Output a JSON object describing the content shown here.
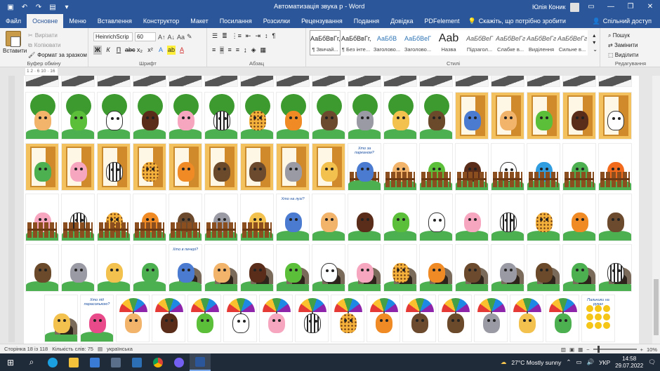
{
  "title_bar": {
    "doc_title": "Автоматизація звука р  -  Word",
    "user_name": "Юлія Коник",
    "qat_icons": [
      "save-icon",
      "undo-icon",
      "redo-icon",
      "new-doc-icon",
      "customize-icon"
    ]
  },
  "tabs": [
    {
      "label": "Файл",
      "active": false
    },
    {
      "label": "Основне",
      "active": true
    },
    {
      "label": "Меню",
      "active": false
    },
    {
      "label": "Вставлення",
      "active": false
    },
    {
      "label": "Конструктор",
      "active": false
    },
    {
      "label": "Макет",
      "active": false
    },
    {
      "label": "Посилання",
      "active": false
    },
    {
      "label": "Розсилки",
      "active": false
    },
    {
      "label": "Рецензування",
      "active": false
    },
    {
      "label": "Подання",
      "active": false
    },
    {
      "label": "Довідка",
      "active": false
    },
    {
      "label": "PDFelement",
      "active": false
    }
  ],
  "tell_me": "Скажіть, що потрібно зробити",
  "share": "Спільний доступ",
  "clipboard": {
    "paste": "Вставити",
    "cut": "Вирізати",
    "copy": "Копіювати",
    "format_painter": "Формат за зразком",
    "group_label": "Буфер обміну"
  },
  "font": {
    "family": "HeinrichScrip",
    "size": "60",
    "group_label": "Шрифт"
  },
  "paragraph": {
    "group_label": "Абзац"
  },
  "styles": {
    "group_label": "Стилі",
    "items": [
      {
        "preview": "АаБбВвГг,",
        "name": "¶ Звичай...",
        "selected": true
      },
      {
        "preview": "АаБбВвГг,",
        "name": "¶ Без інте...",
        "selected": false
      },
      {
        "preview": "АаБбВ",
        "name": "Заголово...",
        "selected": false
      },
      {
        "preview": "АаБбВеГ",
        "name": "Заголово...",
        "selected": false
      },
      {
        "preview": "Aab",
        "name": "Назва",
        "selected": false
      },
      {
        "preview": "АаБбВеГ",
        "name": "Підзагол...",
        "selected": false
      },
      {
        "preview": "АаБбВеГг",
        "name": "Слабке в...",
        "selected": false
      },
      {
        "preview": "АаБбВеГг,",
        "name": "Виділення",
        "selected": false
      },
      {
        "preview": "АаБбВеГг,",
        "name": "Сильне в...",
        "selected": false
      }
    ]
  },
  "editing": {
    "group_label": "Редагування",
    "find": "Пошук",
    "replace": "Замінити",
    "select": "Виділити"
  },
  "ruler_text": "1 2  ·  6  10  ·  16",
  "document": {
    "rows": [
      [
        "road",
        "road",
        "road",
        "road",
        "road",
        "road",
        "road",
        "road",
        "road",
        "road",
        "road",
        "road",
        "road",
        "road",
        "road",
        "road",
        "road"
      ],
      [
        "tree-snail",
        "tree-frog",
        "tree-cow",
        "tree-ant",
        "tree-pig",
        "tree-zebra",
        "tree-cheetah",
        "tree-tiger",
        "tree-ostrich",
        "tree-rhino",
        "tree-giraffe",
        "tree-eagle",
        "door-boy",
        "door-snail",
        "door-frog",
        "door-ant",
        "door-cow"
      ],
      [
        "door-turtle",
        "door-pig",
        "door-zebra",
        "door-cheetah",
        "door-tiger",
        "door-eagle",
        "door-ostrich",
        "door-rhino",
        "door-giraffe",
        "caption-boy-fence",
        "fence-snail",
        "fence-frog",
        "fence-ant",
        "fence-cow",
        "fence-parrot",
        "fence-turtle",
        "fence-fish"
      ],
      [
        "fence-pig",
        "fence-zebra",
        "fence-cheetah",
        "fence-tiger",
        "fence-ostrich",
        "fence-rhino",
        "fence-giraffe",
        "caption-boy",
        "snail",
        "ant",
        "frog",
        "cow",
        "pig",
        "zebra",
        "cheetah",
        "tiger",
        "ostrich"
      ],
      [
        "eagle",
        "rhino",
        "giraffe",
        "turtle",
        "caption-boy-cave",
        "cave-snail",
        "cave-ant",
        "cave-frog",
        "cave-cow",
        "cave-pig",
        "cave-cheetah",
        "cave-tiger",
        "cave-ostrich",
        "cave-rhino",
        "cave-eagle",
        "cave-turtle",
        "cave-zebra"
      ],
      [
        "cave-giraffe",
        "caption-girl",
        "umbrella-snail",
        "umbrella-ant",
        "umbrella-frog",
        "umbrella-cow",
        "umbrella-pig",
        "umbrella-zebra",
        "umbrella-cheetah",
        "umbrella-tiger",
        "umbrella-ostrich",
        "umbrella-eagle",
        "umbrella-rhino",
        "umbrella-giraffe",
        "umbrella-turtle",
        "smileys"
      ]
    ],
    "captions": {
      "boy_fence": "Хто за парканом?",
      "boy": "Хто на лузі?",
      "boy_cave": "Хто в печері?",
      "girl": "Хто під парасолькою?",
      "smileys": "Пальчики на руках"
    }
  },
  "status": {
    "page": "Сторінка 18 із 118",
    "words": "Кількість слів: 75",
    "language": "українська",
    "zoom": "10%",
    "zoom_fraction": 0.1
  },
  "taskbar": {
    "weather": "27°C  Mostly sunny",
    "lang": "УКР",
    "time": "14:58",
    "date": "29.07.2022"
  },
  "colors": {
    "word_blue": "#2b579a",
    "taskbar": "#202b3a"
  }
}
